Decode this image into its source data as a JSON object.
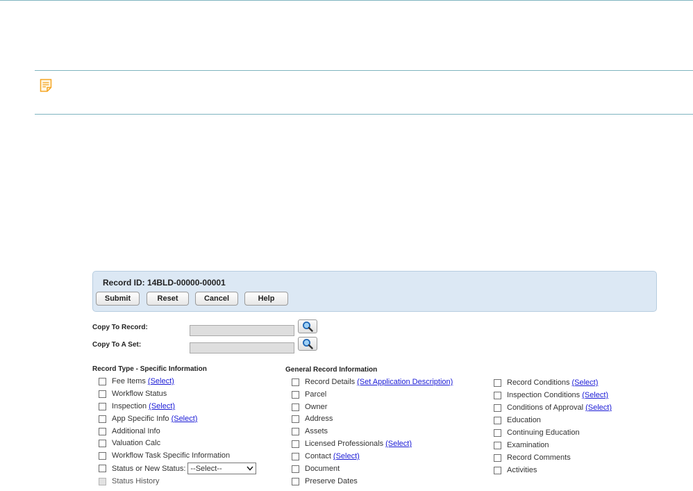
{
  "record": {
    "id_label": "Record ID:",
    "id_value": "14BLD-00000-00001"
  },
  "toolbar": {
    "submit": "Submit",
    "reset": "Reset",
    "cancel": "Cancel",
    "help": "Help"
  },
  "copy": {
    "to_record_label": "Copy To Record:",
    "to_set_label": "Copy To A Set:",
    "to_record_value": "",
    "to_set_value": ""
  },
  "record_type_section": {
    "title": "Record Type - Specific Information",
    "items": [
      {
        "label": "Fee Items",
        "link": "(Select)"
      },
      {
        "label": "Workflow Status"
      },
      {
        "label": "Inspection",
        "link": "(Select)"
      },
      {
        "label": "App Specific Info",
        "link": "(Select)"
      },
      {
        "label": "Additional Info"
      },
      {
        "label": "Valuation Calc"
      },
      {
        "label": "Workflow Task Specific Information"
      },
      {
        "label": "Status or New Status:",
        "select_value": "--Select--"
      },
      {
        "label": "Status History",
        "disabled": true
      }
    ]
  },
  "general_section": {
    "title": "General Record Information",
    "items": [
      {
        "label": "Record Details",
        "link": "(Set Application Description)"
      },
      {
        "label": "Parcel"
      },
      {
        "label": "Owner"
      },
      {
        "label": "Address"
      },
      {
        "label": "Assets"
      },
      {
        "label": "Licensed Professionals",
        "link": "(Select)"
      },
      {
        "label": "Contact",
        "link": "(Select)"
      },
      {
        "label": "Document"
      },
      {
        "label": "Preserve Dates"
      }
    ]
  },
  "extra_section": {
    "items": [
      {
        "label": "Record Conditions",
        "link": "(Select)"
      },
      {
        "label": "Inspection Conditions",
        "link": "(Select)"
      },
      {
        "label": "Conditions of Approval",
        "link": "(Select)"
      },
      {
        "label": "Education"
      },
      {
        "label": "Continuing Education"
      },
      {
        "label": "Examination"
      },
      {
        "label": "Record Comments"
      },
      {
        "label": "Activities"
      }
    ]
  },
  "icons": {
    "note": "note-icon",
    "search": "magnifier-icon"
  },
  "colors": {
    "panel_bg": "#dce8f4",
    "rule": "#7fb4bf",
    "link": "#1a1ad6",
    "note_icon": "#f5a623"
  }
}
